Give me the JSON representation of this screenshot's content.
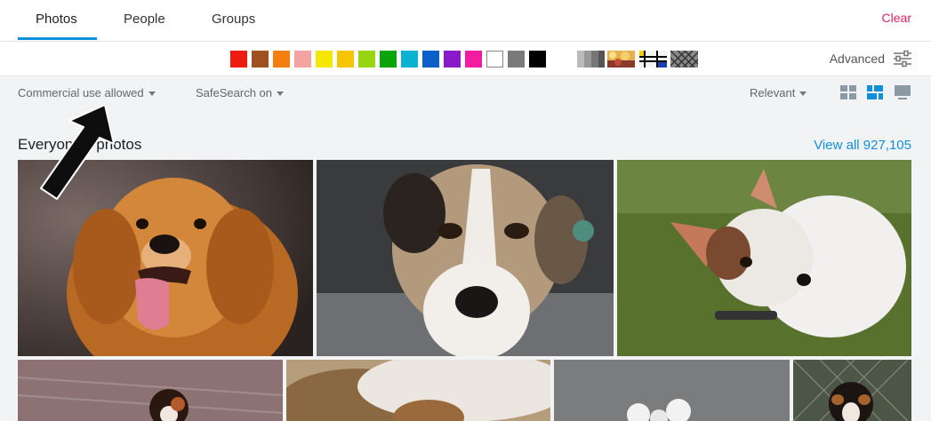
{
  "tabs": [
    {
      "label": "Photos",
      "active": true
    },
    {
      "label": "People",
      "active": false
    },
    {
      "label": "Groups",
      "active": false
    }
  ],
  "clear_label": "Clear",
  "colors": [
    "#ee1c0e",
    "#a0501e",
    "#f47f0f",
    "#f4a3a3",
    "#f5e700",
    "#f4c500",
    "#98d511",
    "#0aa50a",
    "#0bb2d2",
    "#0a5fc9",
    "#8a19c9",
    "#f51d9f",
    "#ffffff",
    "#7a7a7a",
    "#000000"
  ],
  "style_swatches": [
    "black-and-white-icon",
    "shallow-depth-of-field-icon",
    "minimalist-icon",
    "patterns-icon"
  ],
  "advanced_label": "Advanced",
  "filters": {
    "license": "Commercial use allowed",
    "safesearch": "SafeSearch on",
    "sort": "Relevant"
  },
  "section": {
    "title": "Everyone's photos",
    "view_all": "View all 927,105"
  },
  "accent_color": "#128fdc",
  "clear_color": "#e0245e"
}
